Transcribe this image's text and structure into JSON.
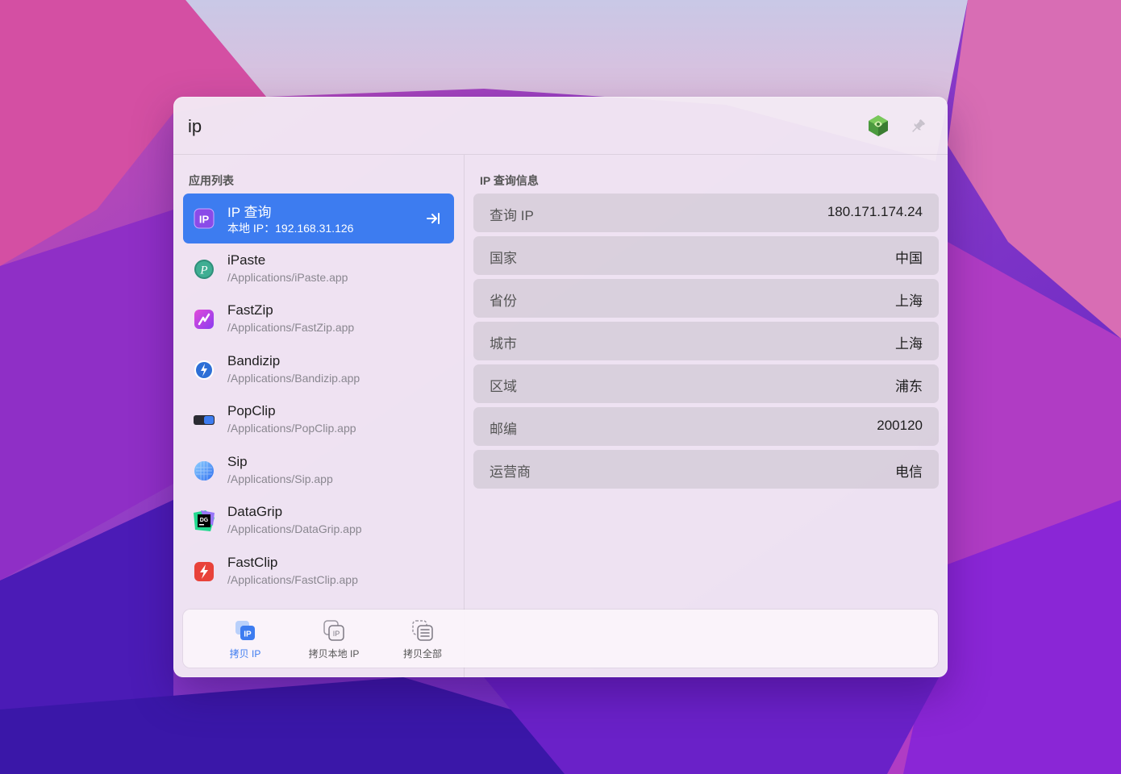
{
  "search": {
    "value": "ip",
    "placeholder": ""
  },
  "left_pane": {
    "title": "应用列表",
    "items": [
      {
        "name": "IP 查询",
        "subtitle": "本地 IP：192.168.31.126",
        "icon": "ip-query-icon",
        "active": true
      },
      {
        "name": "iPaste",
        "subtitle": "/Applications/iPaste.app",
        "icon": "ipaste-app-icon"
      },
      {
        "name": "FastZip",
        "subtitle": "/Applications/FastZip.app",
        "icon": "fastzip-app-icon"
      },
      {
        "name": "Bandizip",
        "subtitle": "/Applications/Bandizip.app",
        "icon": "bandizip-app-icon"
      },
      {
        "name": "PopClip",
        "subtitle": "/Applications/PopClip.app",
        "icon": "popclip-app-icon"
      },
      {
        "name": "Sip",
        "subtitle": "/Applications/Sip.app",
        "icon": "sip-app-icon"
      },
      {
        "name": "DataGrip",
        "subtitle": "/Applications/DataGrip.app",
        "icon": "datagrip-app-icon"
      },
      {
        "name": "FastClip",
        "subtitle": "/Applications/FastClip.app",
        "icon": "fastclip-app-icon"
      }
    ]
  },
  "right_pane": {
    "title": "IP 查询信息",
    "rows": [
      {
        "key": "查询 IP",
        "value": "180.171.174.24"
      },
      {
        "key": "国家",
        "value": "中国"
      },
      {
        "key": "省份",
        "value": "上海"
      },
      {
        "key": "城市",
        "value": "上海"
      },
      {
        "key": "区域",
        "value": "浦东"
      },
      {
        "key": "邮编",
        "value": "200120"
      },
      {
        "key": "运营商",
        "value": "电信"
      }
    ]
  },
  "actions": [
    {
      "label": "拷贝 IP",
      "icon": "copy-ip-icon",
      "primary": true
    },
    {
      "label": "拷贝本地 IP",
      "icon": "copy-local-ip-icon"
    },
    {
      "label": "拷贝全部",
      "icon": "copy-all-icon"
    }
  ],
  "colors": {
    "accent": "#3d7cf0",
    "window_bg": "#f3e9f4",
    "row_bg": "#dcd6de"
  }
}
